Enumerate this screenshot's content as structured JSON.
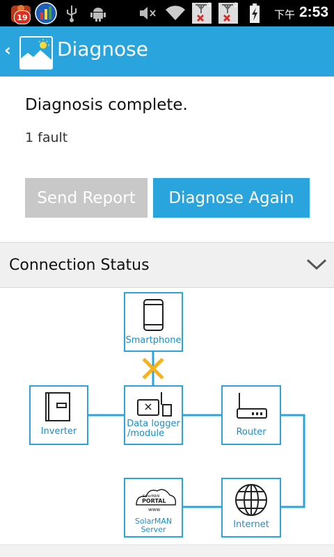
{
  "status_bar": {
    "notification_count": "19",
    "usb_icon": "usb-icon",
    "debug_icon": "android-debug-icon",
    "sim1_label": "1",
    "sim2_label": "2",
    "am_pm": "下午",
    "time": "2:53"
  },
  "action_bar": {
    "back_glyph": "‹",
    "title": "Diagnose",
    "accent_color": "#29a4dd"
  },
  "diagnosis": {
    "status": "Diagnosis complete.",
    "fault_summary": "1 fault"
  },
  "buttons": {
    "send_report": "Send Report",
    "diagnose_again": "Diagnose Again"
  },
  "connection_status": {
    "title": "Connection Status",
    "nodes": {
      "smartphone": "Smartphone",
      "data_logger_line1": "Data logger",
      "data_logger_line2": "/module",
      "inverter": "Inverter",
      "router": "Router",
      "solarman_line1": "SolarMAN",
      "solarman_line2": "Server",
      "internet": "Internet",
      "portal_small": "SolarMAN",
      "portal_text": "PORTAL",
      "portal_www": "www"
    },
    "fault_link": "smartphone-to-data-logger",
    "fault_color": "#f5b21b",
    "line_color": "#29a4dd"
  }
}
